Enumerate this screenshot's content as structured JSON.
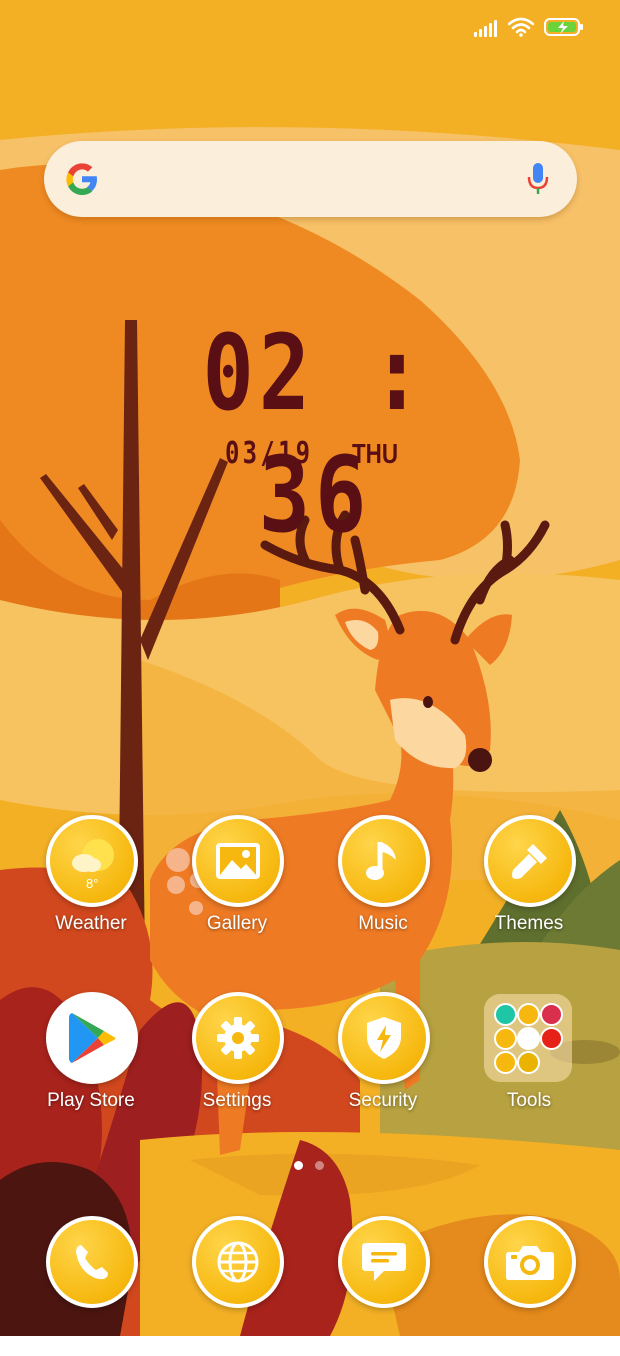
{
  "status_bar": {
    "icons": [
      "signal-icon",
      "wifi-icon",
      "battery-charging-icon"
    ]
  },
  "search_bar": {
    "left_icon": "google-g-icon",
    "right_icon": "microphone-icon"
  },
  "clock": {
    "time": "02 : 36",
    "date": "03/19",
    "day": "THU"
  },
  "apps": {
    "weather": {
      "label": "Weather",
      "icon": "weather-icon",
      "temperature": "8°"
    },
    "gallery": {
      "label": "Gallery",
      "icon": "gallery-icon"
    },
    "music": {
      "label": "Music",
      "icon": "music-note-icon"
    },
    "themes": {
      "label": "Themes",
      "icon": "paintbrush-icon"
    },
    "play_store": {
      "label": "Play Store",
      "icon": "play-store-icon"
    },
    "settings": {
      "label": "Settings",
      "icon": "gear-icon"
    },
    "security": {
      "label": "Security",
      "icon": "shield-icon"
    },
    "tools": {
      "label": "Tools",
      "icon": "folder-icon"
    }
  },
  "dock": [
    {
      "icon": "phone-icon"
    },
    {
      "icon": "globe-icon"
    },
    {
      "icon": "message-icon"
    },
    {
      "icon": "camera-icon"
    }
  ],
  "page_indicator": {
    "pages": 2,
    "active": 1
  },
  "colors": {
    "icon_yellow": "#f6b80f",
    "clock_color": "#5a0f14",
    "sky": "#f3b025"
  }
}
